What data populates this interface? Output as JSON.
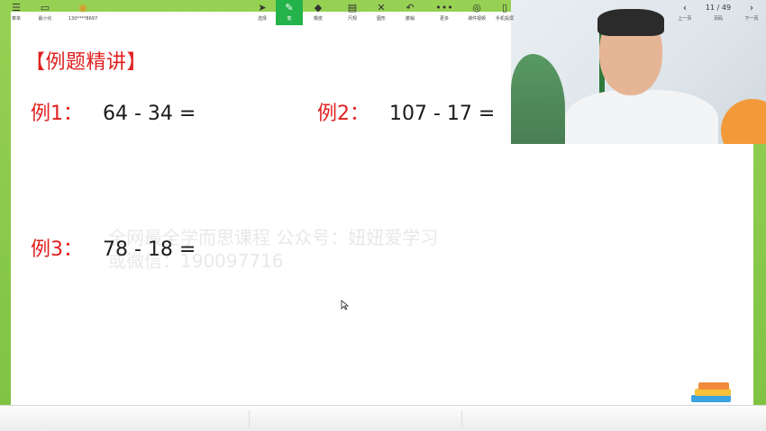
{
  "slide": {
    "title": "【例题精讲】",
    "examples": [
      {
        "label": "例1：",
        "expr": "64 - 34 ="
      },
      {
        "label": "例2：",
        "expr": "107 - 17 ="
      },
      {
        "label": "例3：",
        "expr": "78 - 18 ="
      }
    ],
    "watermark_line1": "全网最全学而思课程 公众号：妞妞爱学习",
    "watermark_line2": "或微信：190097716"
  },
  "toolbar": {
    "left": [
      {
        "icon": "☰",
        "label": "菜单"
      },
      {
        "icon": "▭",
        "label": "最小化"
      },
      {
        "icon": "◉",
        "label": "130****8697"
      }
    ],
    "tools": [
      {
        "icon": "➤",
        "label": "选择"
      },
      {
        "icon": "✎",
        "label": "笔"
      },
      {
        "icon": "◆",
        "label": "橡皮"
      },
      {
        "icon": "▤",
        "label": "尺规"
      },
      {
        "icon": "✕",
        "label": "图形"
      },
      {
        "icon": "↶",
        "label": "撤销"
      },
      {
        "icon": "•••",
        "label": "更多"
      },
      {
        "icon": "◎",
        "label": "课件视频"
      },
      {
        "icon": "▯",
        "label": "手机投屏"
      }
    ],
    "prev_label": "上一页",
    "next_label": "下一页",
    "page_label": "页码",
    "page_indicator": "11 / 49"
  },
  "colors": {
    "accent_red": "#e02020",
    "border_green": "#8fce4a",
    "active_tool": "#24b24a"
  }
}
